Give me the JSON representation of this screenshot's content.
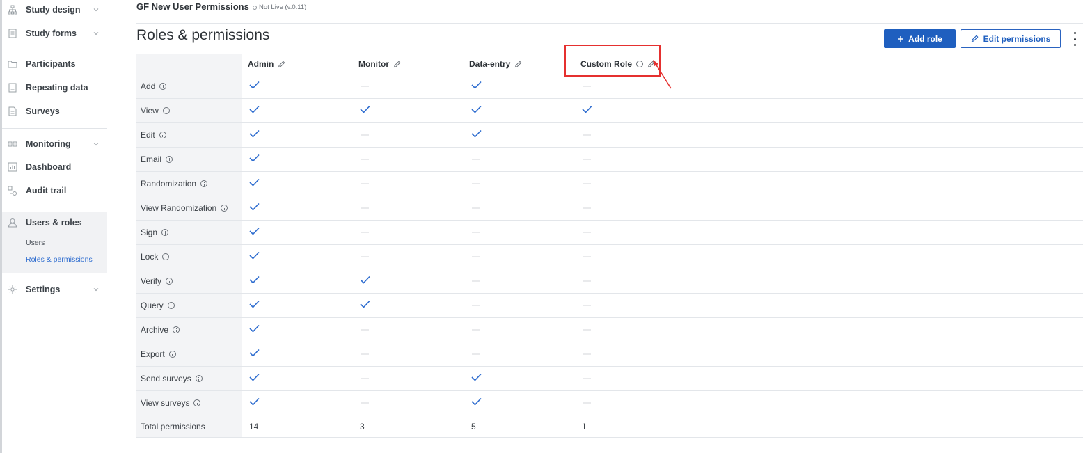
{
  "sidebar": {
    "items": [
      {
        "label": "Study design",
        "icon": "hierarchy-icon",
        "chevron": true
      },
      {
        "label": "Study forms",
        "icon": "form-icon",
        "chevron": true
      },
      {
        "label": "Participants",
        "icon": "folder-icon",
        "chevron": false
      },
      {
        "label": "Repeating data",
        "icon": "document-icon",
        "chevron": false
      },
      {
        "label": "Surveys",
        "icon": "survey-icon",
        "chevron": false
      },
      {
        "label": "Monitoring",
        "icon": "monitoring-icon",
        "chevron": true
      },
      {
        "label": "Dashboard",
        "icon": "chart-icon",
        "chevron": false
      },
      {
        "label": "Audit trail",
        "icon": "audit-icon",
        "chevron": false
      },
      {
        "label": "Users & roles",
        "icon": "user-icon",
        "chevron": false
      },
      {
        "label": "Settings",
        "icon": "gear-icon",
        "chevron": true
      }
    ],
    "sub_items": [
      "Users",
      "Roles & permissions"
    ],
    "active_sub": "Roles & permissions"
  },
  "header": {
    "app_title": "GF New User Permissions",
    "status": "Not Live (v.0.11)",
    "page_title": "Roles & permissions",
    "add_role_label": "Add role",
    "edit_permissions_label": "Edit permissions"
  },
  "table": {
    "columns": [
      "Admin",
      "Monitor",
      "Data-entry",
      "Custom Role"
    ],
    "rows": [
      {
        "label": "Add",
        "values": [
          true,
          false,
          true,
          false
        ]
      },
      {
        "label": "View",
        "values": [
          true,
          true,
          true,
          true
        ]
      },
      {
        "label": "Edit",
        "values": [
          true,
          false,
          true,
          false
        ]
      },
      {
        "label": "Email",
        "values": [
          true,
          false,
          false,
          false
        ]
      },
      {
        "label": "Randomization",
        "values": [
          true,
          false,
          false,
          false
        ]
      },
      {
        "label": "View Randomization",
        "values": [
          true,
          false,
          false,
          false
        ]
      },
      {
        "label": "Sign",
        "values": [
          true,
          false,
          false,
          false
        ]
      },
      {
        "label": "Lock",
        "values": [
          true,
          false,
          false,
          false
        ]
      },
      {
        "label": "Verify",
        "values": [
          true,
          true,
          false,
          false
        ]
      },
      {
        "label": "Query",
        "values": [
          true,
          true,
          false,
          false
        ]
      },
      {
        "label": "Archive",
        "values": [
          true,
          false,
          false,
          false
        ]
      },
      {
        "label": "Export",
        "values": [
          true,
          false,
          false,
          false
        ]
      },
      {
        "label": "Send surveys",
        "values": [
          true,
          false,
          true,
          false
        ]
      },
      {
        "label": "View surveys",
        "values": [
          true,
          false,
          true,
          false
        ]
      }
    ],
    "totals_label": "Total permissions",
    "totals": [
      "14",
      "3",
      "5",
      "1"
    ]
  },
  "colors": {
    "accent": "#1f5fbf",
    "check": "#2d6ccf",
    "highlight": "#e5302f",
    "active_link": "#2d6ccf"
  }
}
